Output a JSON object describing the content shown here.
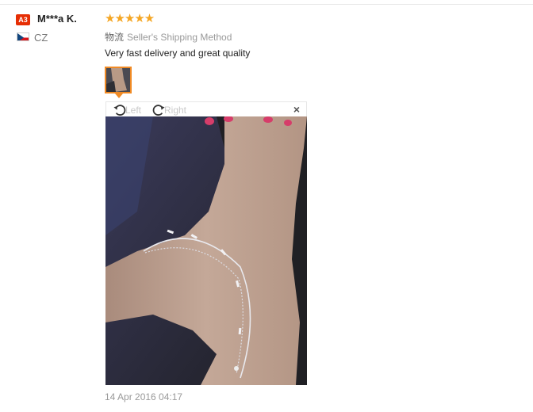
{
  "review": {
    "badge": "A3",
    "username": "M***a K.",
    "country_code": "CZ",
    "country_flag_icon": "czech-flag-icon",
    "rating": 5,
    "stars": "★★★★★",
    "shipping_label": "物流",
    "shipping_method": "Seller's Shipping Method",
    "text": "Very fast delivery and great quality",
    "date": "14 Apr 2016 04:17"
  },
  "viewer": {
    "rotate_left_label": "Left",
    "rotate_right_label": "Right",
    "close_label": "×",
    "thumbnail_count": 1
  },
  "colors": {
    "badge_bg": "#e62e04",
    "star": "#f5a623",
    "thumb_border": "#f08a24",
    "muted_text": "#999999"
  }
}
